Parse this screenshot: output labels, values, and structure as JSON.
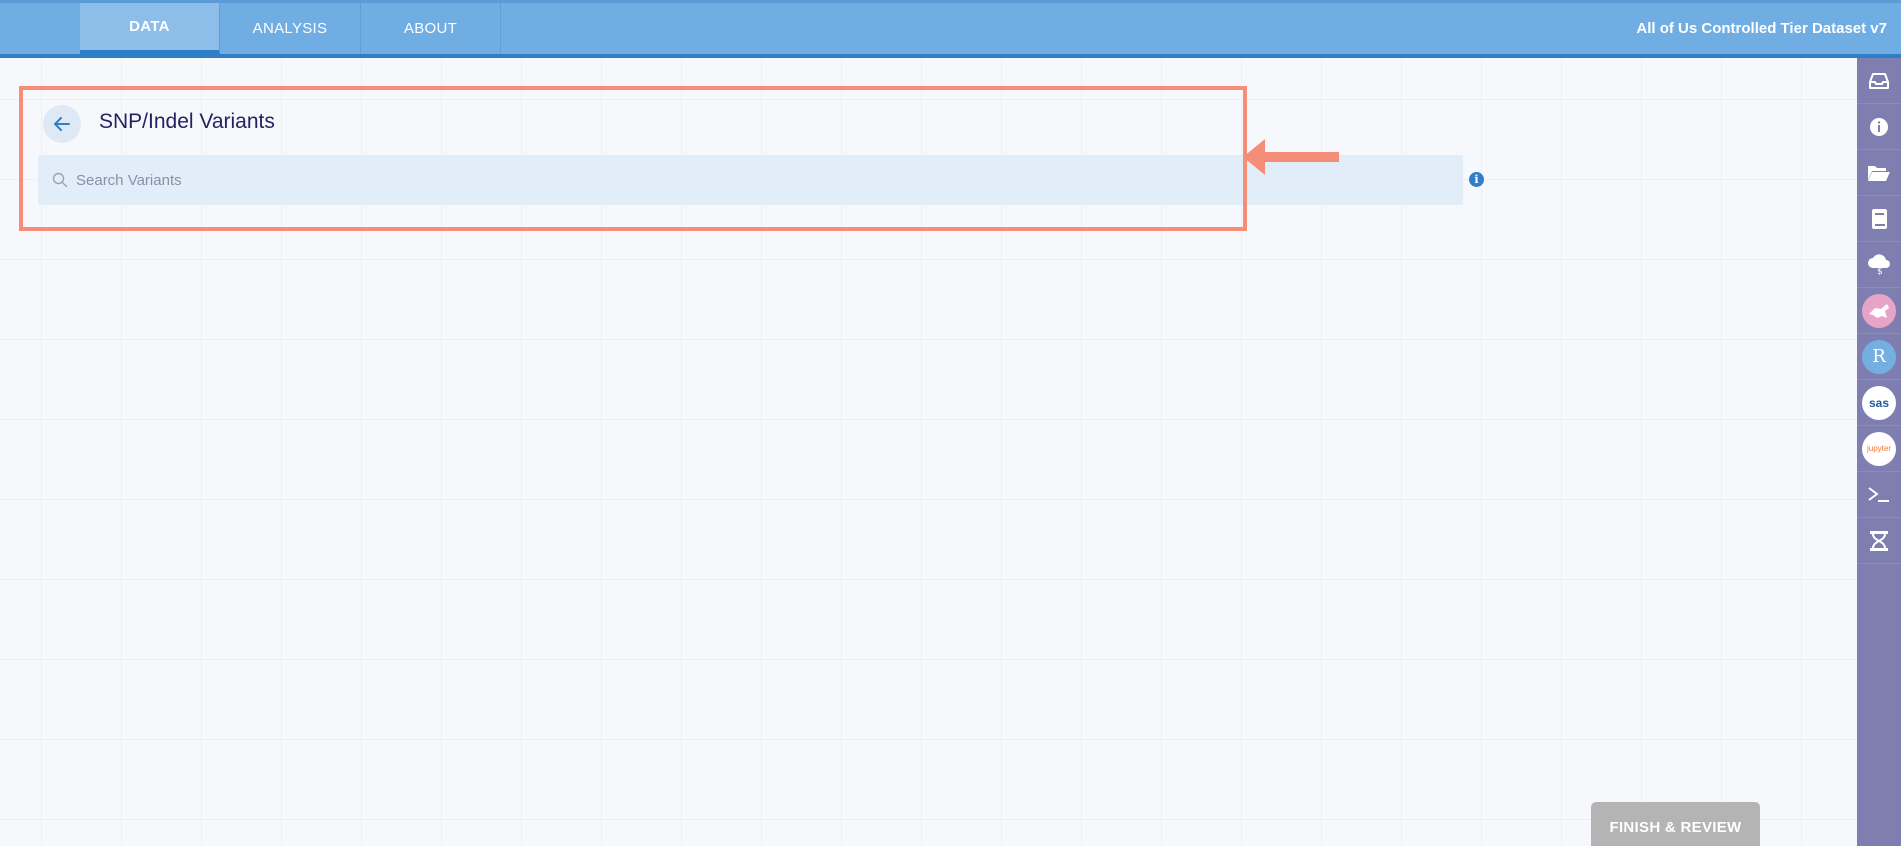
{
  "nav": {
    "tabs": [
      {
        "label": "DATA",
        "active": true
      },
      {
        "label": "ANALYSIS",
        "active": false
      },
      {
        "label": "ABOUT",
        "active": false
      }
    ],
    "workspace_name": "All of Us Controlled Tier Dataset v7"
  },
  "page": {
    "title": "SNP/Indel Variants",
    "back_icon": "arrow-left-icon"
  },
  "search": {
    "placeholder": "Search Variants",
    "value": "",
    "icon": "search-icon",
    "info_icon": "info-icon"
  },
  "footer": {
    "finish_label": "FINISH & REVIEW"
  },
  "sidebar": {
    "items": [
      {
        "icon": "inbox-icon"
      },
      {
        "icon": "info-circle-icon"
      },
      {
        "icon": "folder-open-icon"
      },
      {
        "icon": "book-icon"
      },
      {
        "icon": "cloud-cost-icon"
      },
      {
        "icon": "cromwell-icon"
      },
      {
        "icon": "rstudio-icon",
        "label": "R"
      },
      {
        "icon": "sas-icon",
        "label": "sas"
      },
      {
        "icon": "jupyter-icon",
        "label": "jupyter"
      },
      {
        "icon": "terminal-icon"
      },
      {
        "icon": "dna-icon"
      }
    ]
  },
  "colors": {
    "nav_bg": "#6fade3",
    "nav_active": "#8dbeea",
    "accent": "#2f7fc8",
    "sidebar_bg": "#7e7fb0",
    "highlight": "#f48e78",
    "search_bg": "#e1edf9",
    "title_text": "#262262"
  }
}
